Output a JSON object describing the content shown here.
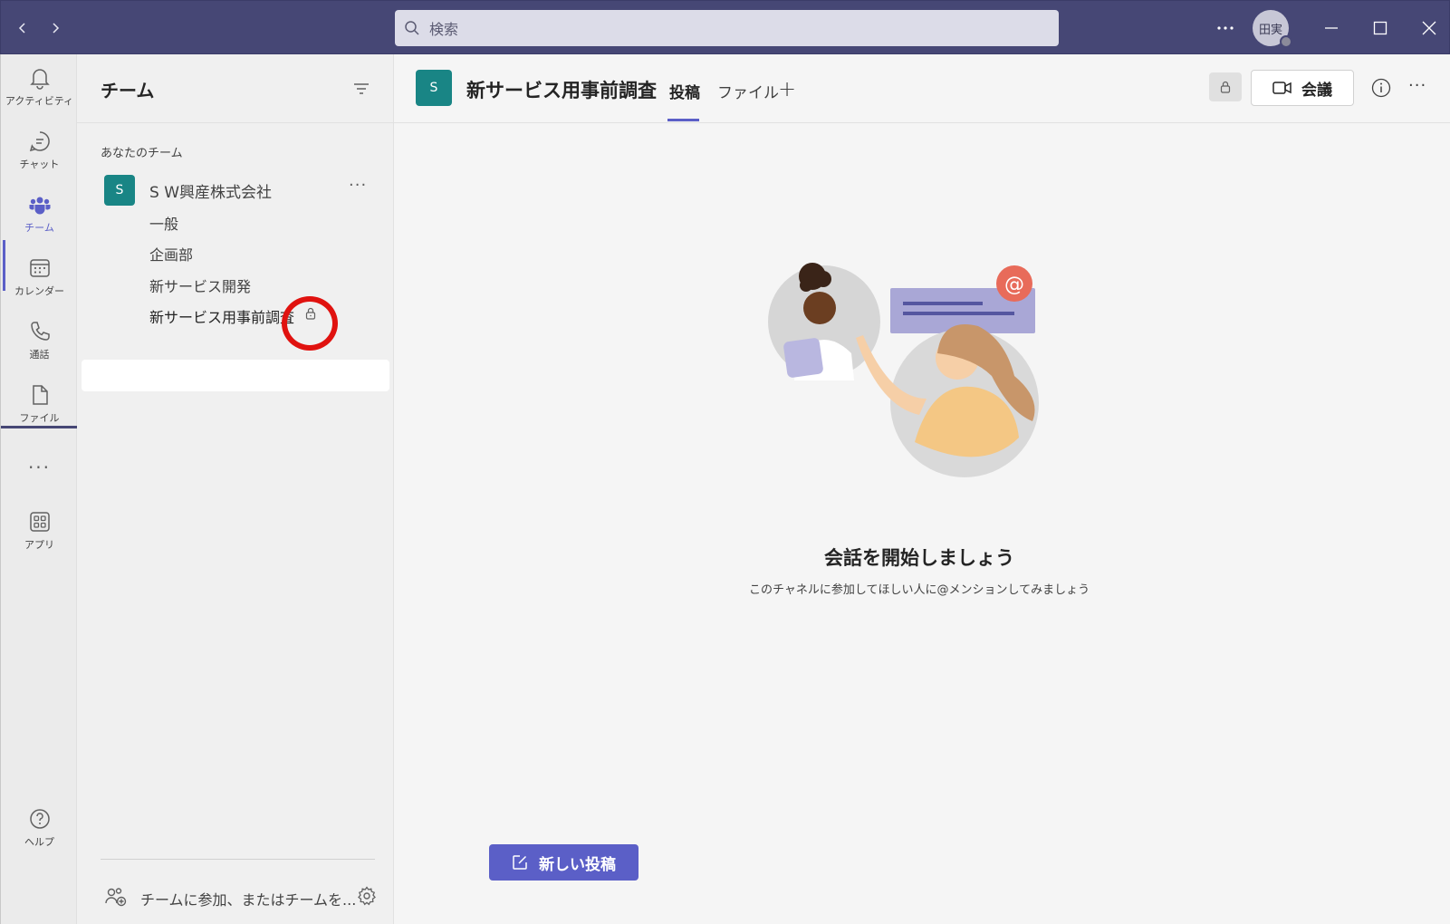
{
  "titlebar": {
    "search_placeholder": "検索",
    "avatar_initials": "田実"
  },
  "rail": {
    "items": [
      {
        "label": "アクティビティ",
        "icon": "bell-icon"
      },
      {
        "label": "チャット",
        "icon": "chat-icon"
      },
      {
        "label": "チーム",
        "icon": "teams-icon"
      },
      {
        "label": "カレンダー",
        "icon": "calendar-icon"
      },
      {
        "label": "通話",
        "icon": "phone-icon"
      },
      {
        "label": "ファイル",
        "icon": "file-icon"
      },
      {
        "label": "アプリ",
        "icon": "apps-icon"
      },
      {
        "label": "ヘルプ",
        "icon": "help-icon"
      }
    ],
    "more": "···"
  },
  "teams_panel": {
    "title": "チーム",
    "section_label": "あなたのチーム",
    "team": {
      "initial": "S",
      "name": "S W興産株式会社",
      "more": "···",
      "channels": [
        "一般",
        "企画部",
        "新サービス開発",
        "新サービス用事前調査"
      ]
    },
    "join_label": "チームに参加、またはチームを..."
  },
  "channel_header": {
    "initial": "S",
    "title": "新サービス用事前調査",
    "tabs": [
      "投稿",
      "ファイル"
    ],
    "add_tab": "+",
    "meet_label": "会議",
    "more": "···"
  },
  "main": {
    "empty_title": "会話を開始しましょう",
    "empty_subtitle": "このチャネルに参加してほしい人に@メンションしてみましょう",
    "new_post_label": "新しい投稿"
  },
  "colors": {
    "titlebar": "#464775",
    "accent": "#5b5fc7",
    "team_avatar": "#198585",
    "highlight": "#e0120f"
  }
}
